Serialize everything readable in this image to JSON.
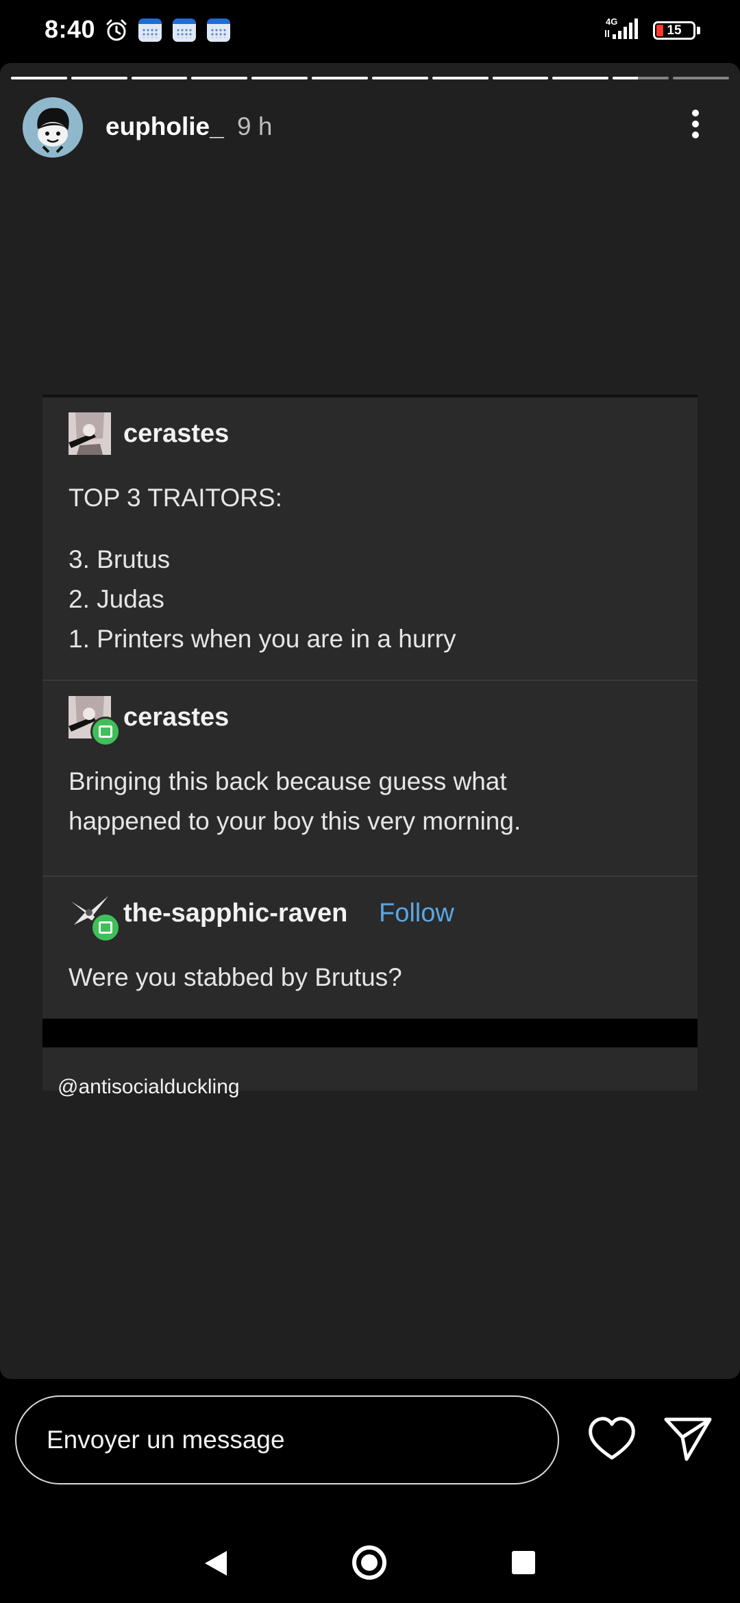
{
  "status_bar": {
    "time": "8:40",
    "network": "4G",
    "battery": "15",
    "icons": [
      "alarm-icon",
      "calendar-icon",
      "calendar-icon",
      "calendar-icon",
      "signal-icon",
      "battery-icon"
    ]
  },
  "story": {
    "username": "eupholie_",
    "time_ago": "9 h",
    "segments_total": 12,
    "current_segment": 11,
    "current_segment_progress": 0.45
  },
  "post": {
    "entries": [
      {
        "user": "cerastes",
        "lines": [
          "TOP 3 TRAITORS:",
          "3. Brutus",
          "2. Judas",
          "1. Printers when you are in a hurry"
        ]
      },
      {
        "user": "cerastes",
        "lines": [
          "Bringing this back because guess what",
          "happened to your boy this very morning."
        ]
      },
      {
        "user": "the-sapphic-raven",
        "follow_label": "Follow",
        "lines": [
          "Were you stabbed by Brutus?"
        ]
      }
    ],
    "credit": "@antisocialduckling"
  },
  "reply": {
    "placeholder": "Envoyer un message"
  },
  "colors": {
    "story_bg": "#202020",
    "card_bg": "#2a2a2a",
    "follow": "#5aa7e6",
    "reblog": "#3fbf5a",
    "battery_low": "#ff3b30"
  }
}
